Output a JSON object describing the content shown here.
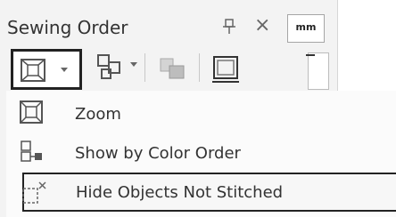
{
  "panel": {
    "title": "Sewing Order",
    "close_glyph": "×",
    "tab_label": "mm"
  },
  "toolbar": {
    "buttons": [
      {
        "name": "zoom-dropdown-button",
        "icon": "zoom-icon"
      },
      {
        "name": "sort-dropdown-button",
        "icon": "color-order-icon"
      },
      {
        "name": "grayed-button",
        "icon": "layers-icon"
      },
      {
        "name": "frame-button",
        "icon": "frame-icon"
      }
    ]
  },
  "menu": {
    "items": [
      {
        "label": "Zoom",
        "icon": "zoom-icon"
      },
      {
        "label": "Show by Color Order",
        "icon": "color-order-icon"
      },
      {
        "label": "Hide Objects Not Stitched",
        "icon": "hide-objects-icon"
      }
    ]
  },
  "colors": {
    "panel_bg": "#f3f3f3",
    "menu_bg": "#fbfbfb",
    "highlight_border": "#222222",
    "text": "#333333"
  }
}
